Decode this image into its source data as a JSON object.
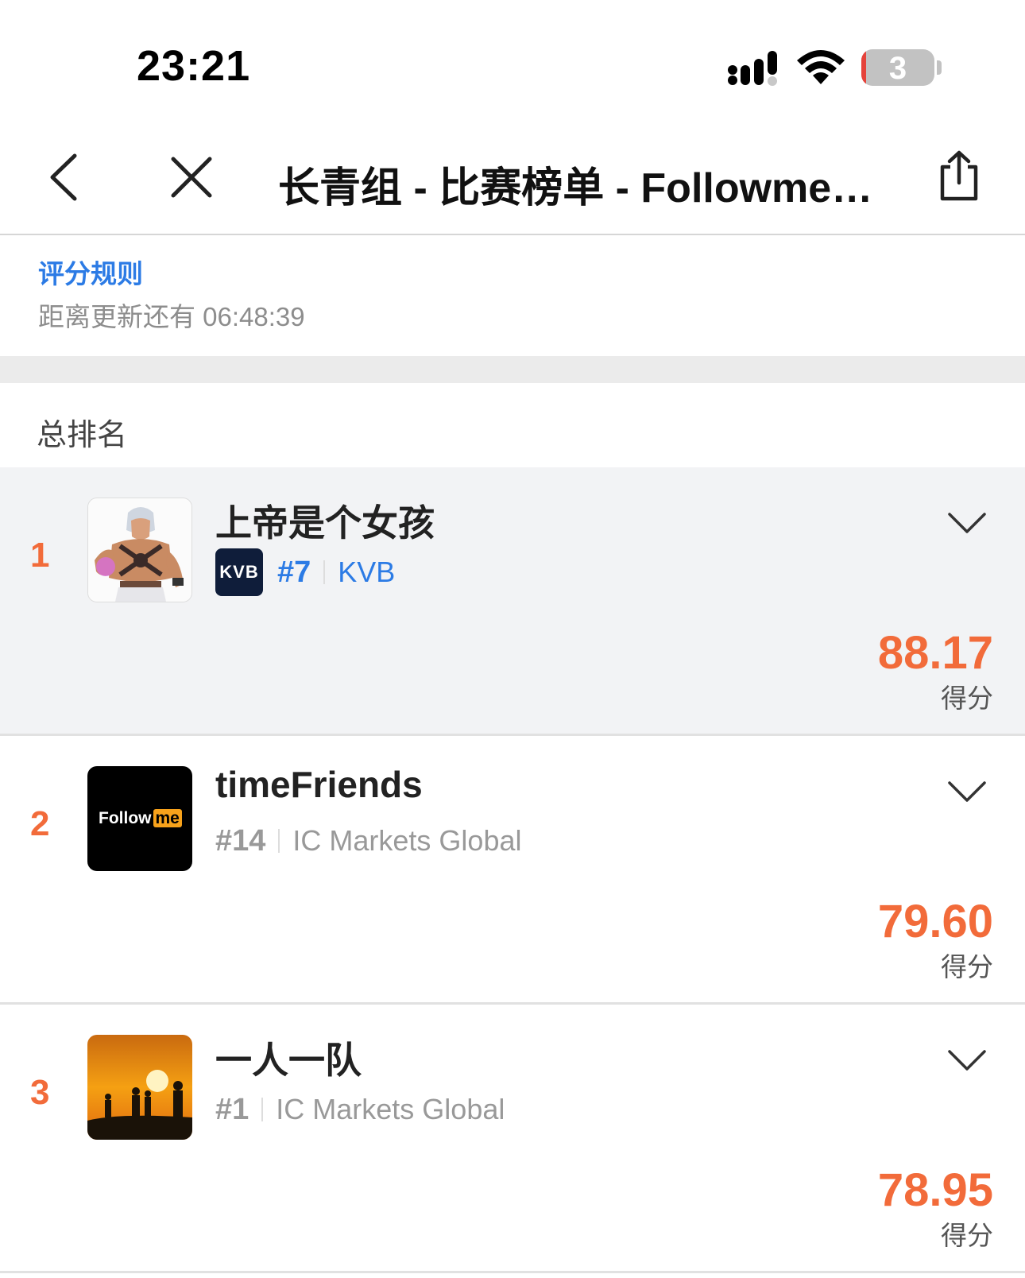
{
  "status_bar": {
    "time": "23:21",
    "battery": "3"
  },
  "nav": {
    "title": "长青组 - 比赛榜单 - Followme…",
    "back_icon": "chevron-left-icon",
    "close_icon": "close-icon",
    "share_icon": "share-icon"
  },
  "info": {
    "rules_link": "评分规则",
    "countdown": "距离更新还有 06:48:39"
  },
  "section_title": "总排名",
  "score_label": "得分",
  "ranking": [
    {
      "rank": "1",
      "name": "上帝是个女孩",
      "broker_logo": "KVB",
      "broker_rank": "#7",
      "broker": "KVB",
      "score": "88.17",
      "avatar": "fighter-character-avatar"
    },
    {
      "rank": "2",
      "name": "timeFriends",
      "broker_rank": "#14",
      "broker": "IC Markets Global",
      "score": "79.60",
      "avatar_text_a": "Follow",
      "avatar_text_b": "me"
    },
    {
      "rank": "3",
      "name": "一人一队",
      "broker_rank": "#1",
      "broker": "IC Markets Global",
      "score": "78.95",
      "avatar": "sunset-silhouette-avatar"
    }
  ],
  "colors": {
    "accent": "#f26b3a",
    "link": "#2c7be5",
    "highlight_bg": "#f2f3f5"
  }
}
